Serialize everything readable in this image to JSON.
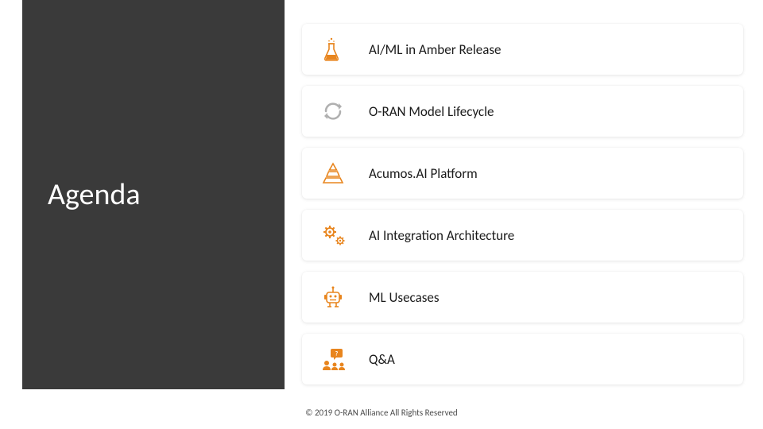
{
  "sidebar": {
    "title": "Agenda"
  },
  "items": [
    {
      "label": "AI/ML in Amber Release"
    },
    {
      "label": "O-RAN Model Lifecycle"
    },
    {
      "label": "Acumos.AI Platform"
    },
    {
      "label": "AI Integration Architecture"
    },
    {
      "label": "ML Usecases"
    },
    {
      "label": "Q&A"
    }
  ],
  "footer": {
    "copyright": "© 2019 O-RAN Alliance   All Rights Reserved"
  },
  "colors": {
    "orange": "#e8851e",
    "gray": "#b0b0b0",
    "dark": "#3a3a3a"
  }
}
